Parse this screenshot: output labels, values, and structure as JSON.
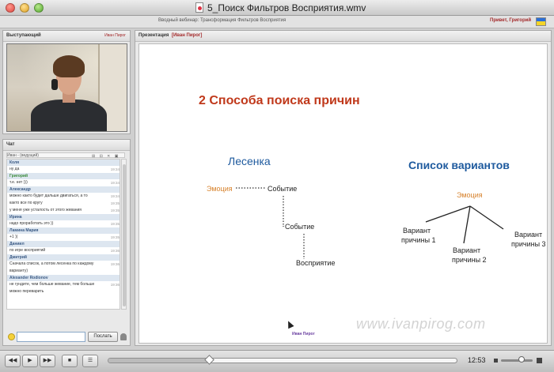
{
  "window": {
    "title": "5_Поиск Фильтров Восприятия.wmv"
  },
  "app": {
    "webinar_title": "Вводный вебинар: Трансформация Фильтров Восприятия",
    "greeting": "Привет, Григорий"
  },
  "speaker": {
    "panel_title": "Выступающий",
    "name": "Иван Пирог"
  },
  "chat": {
    "panel_title": "Чат",
    "header_row": "Иван - (ведущий)",
    "controls": "⊞ ⊟ ✕ ▣",
    "send_label": "Послать",
    "input_value": "",
    "messages": [
      {
        "name": "Коля",
        "color": "blue",
        "lines": [
          {
            "text": "ну да",
            "time": "19:34"
          }
        ]
      },
      {
        "name": "Григорий",
        "color": "green",
        "lines": [
          {
            "text": "т.е. нет )))",
            "time": "19:34"
          }
        ]
      },
      {
        "name": "Александр",
        "color": "blue",
        "lines": [
          {
            "text": "можно както будет дальше двигаться, а то",
            "time": "19:34"
          },
          {
            "text": "както все по кругу",
            "time": "19:35"
          },
          {
            "text": "у меня уже усталость от этого жевания",
            "time": "19:35"
          }
        ]
      },
      {
        "name": "Ирина",
        "color": "blue",
        "lines": [
          {
            "text": "надо проработать это ))",
            "time": "19:35"
          }
        ]
      },
      {
        "name": "Ламина Мария",
        "color": "blue",
        "lines": [
          {
            "text": "+1 ))",
            "time": "19:35"
          }
        ]
      },
      {
        "name": "Даниил",
        "color": "blue",
        "lines": [
          {
            "text": "по игре восприятий",
            "time": "19:36"
          }
        ]
      },
      {
        "name": "Дмитрий",
        "color": "blue",
        "lines": [
          {
            "text": "Сначала список, а потом лесенка по каждому",
            "time": "19:36"
          },
          {
            "text": "варианту)",
            "time": ""
          }
        ]
      },
      {
        "name": "Alexander Rodionov",
        "color": "blue",
        "lines": [
          {
            "text": "не гундите, чем больше жевание, тем больше",
            "time": "19:36"
          },
          {
            "text": "можно переварить",
            "time": ""
          }
        ]
      }
    ]
  },
  "presentation": {
    "label": "Презентация",
    "owner": "[Иван Пирог]",
    "slide": {
      "title": "2 Способа поиска причин",
      "ladder_title": "Лесенка",
      "options_title": "Список вариантов",
      "ladder": {
        "emotion": "Эмоция",
        "event1": "Событие",
        "event2": "Событие",
        "perception": "Восприятие"
      },
      "options": {
        "emotion": "Эмоция",
        "v1_line1": "Вариант",
        "v1_line2": "причины 1",
        "v2_line1": "Вариант",
        "v2_line2": "причины 2",
        "v3_line1": "Вариант",
        "v3_line2": "причины 3"
      },
      "watermark": "www.ivanpirog.com",
      "footer": "Иван Пирог"
    }
  },
  "player": {
    "time": "12:53",
    "progress": 0.29,
    "volume": 0.65,
    "buttons": {
      "rewind": "◀◀",
      "play": "▶",
      "forward": "▶▶",
      "stop": "■",
      "menu": "☰"
    }
  }
}
